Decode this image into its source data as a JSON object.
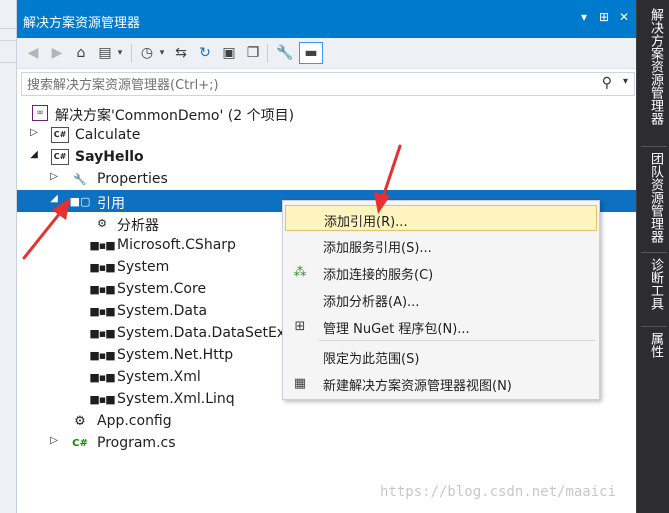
{
  "titlebar": {
    "title": "解决方案资源管理器",
    "controls": [
      "▾",
      "⊞",
      "✕"
    ]
  },
  "search": {
    "placeholder": "搜索解决方案资源管理器(Ctrl+;)"
  },
  "tree": {
    "solution": "解决方案'CommonDemo' (2 个项目)",
    "calculate": "Calculate",
    "sayhello": "SayHello",
    "properties": "Properties",
    "references": "引用",
    "analyzers": "分析器",
    "refs": [
      "Microsoft.CSharp",
      "System",
      "System.Core",
      "System.Data",
      "System.Data.DataSetExte",
      "System.Net.Http",
      "System.Xml",
      "System.Xml.Linq"
    ],
    "appconfig": "App.config",
    "program": "Program.cs"
  },
  "menu": {
    "items": [
      "添加引用(R)...",
      "添加服务引用(S)...",
      "添加连接的服务(C)",
      "添加分析器(A)...",
      "管理 NuGet 程序包(N)...",
      "限定为此范围(S)",
      "新建解决方案资源管理器视图(N)"
    ]
  },
  "right_tabs": [
    "解决方案资源管理器",
    "团队资源管理器",
    "诊断工具",
    "属性"
  ],
  "watermark": "https://blog.csdn.net/maaici",
  "colors": {
    "titlebar": "#007acc",
    "selection": "#0e70c0",
    "menu_highlight": "#fdf4bf",
    "annotation": "#e8312f"
  }
}
